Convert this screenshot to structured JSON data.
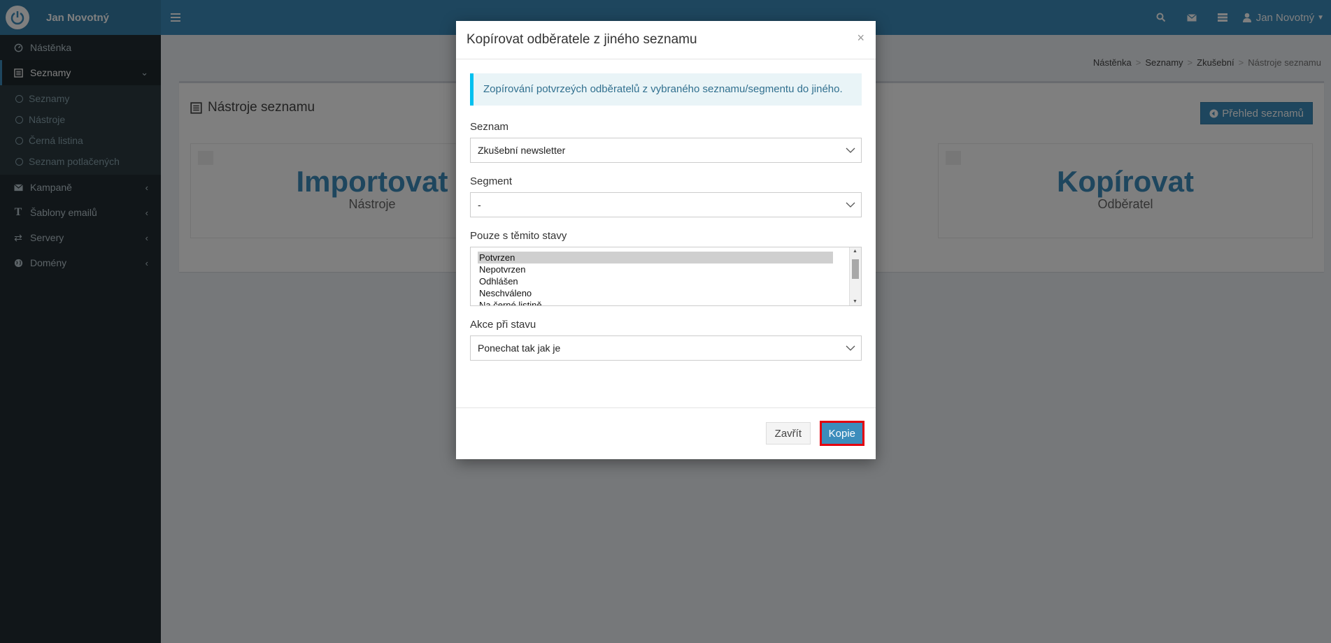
{
  "app": {
    "brand_name": "Jan Novotný",
    "user_name": "Jan Novotný"
  },
  "sidebar": {
    "items": [
      {
        "label": "Nástěnka",
        "icon": "dashboard-icon"
      },
      {
        "label": "Seznamy",
        "icon": "list-icon",
        "active": true
      },
      {
        "label": "Kampaně",
        "icon": "envelope-icon"
      },
      {
        "label": "Šablony emailů",
        "icon": "text-icon"
      },
      {
        "label": "Servery",
        "icon": "exchange-icon"
      },
      {
        "label": "Domény",
        "icon": "globe-icon"
      }
    ],
    "subitems": [
      "Seznamy",
      "Nástroje",
      "Černá listina",
      "Seznam potlačených"
    ]
  },
  "breadcrumb": [
    "Nástěnka",
    "Seznamy",
    "Zkušební",
    "Nástroje seznamu"
  ],
  "page": {
    "title": "Nástroje seznamu",
    "overview_button": "Přehled seznamů",
    "cards": [
      {
        "big": "Importovat",
        "small": "Nástroje"
      },
      {
        "big": "Kopírovat",
        "small": "Odběratel"
      }
    ]
  },
  "modal": {
    "title": "Kopírovat odběratele z jiného seznamu",
    "close_symbol": "×",
    "info_text": "Zopírování potvrzeých odběratelů z vybraného seznamu/segmentu do jiného.",
    "fields": {
      "list_label": "Seznam",
      "list_value": "Zkušební newsletter",
      "segment_label": "Segment",
      "segment_value": "-",
      "states_label": "Pouze s těmito stavy",
      "states_options": [
        "Potvrzen",
        "Nepotvrzen",
        "Odhlášen",
        "Neschváleno",
        "Na černé listině"
      ],
      "states_selected": "Potvrzen",
      "action_label": "Akce při stavu",
      "action_value": "Ponechat tak jak je"
    },
    "close_button": "Zavřít",
    "copy_button": "Kopie"
  },
  "colors": {
    "primary": "#3c8dbc",
    "sidebar_bg": "#222d32",
    "highlight_border": "#e3000f"
  }
}
